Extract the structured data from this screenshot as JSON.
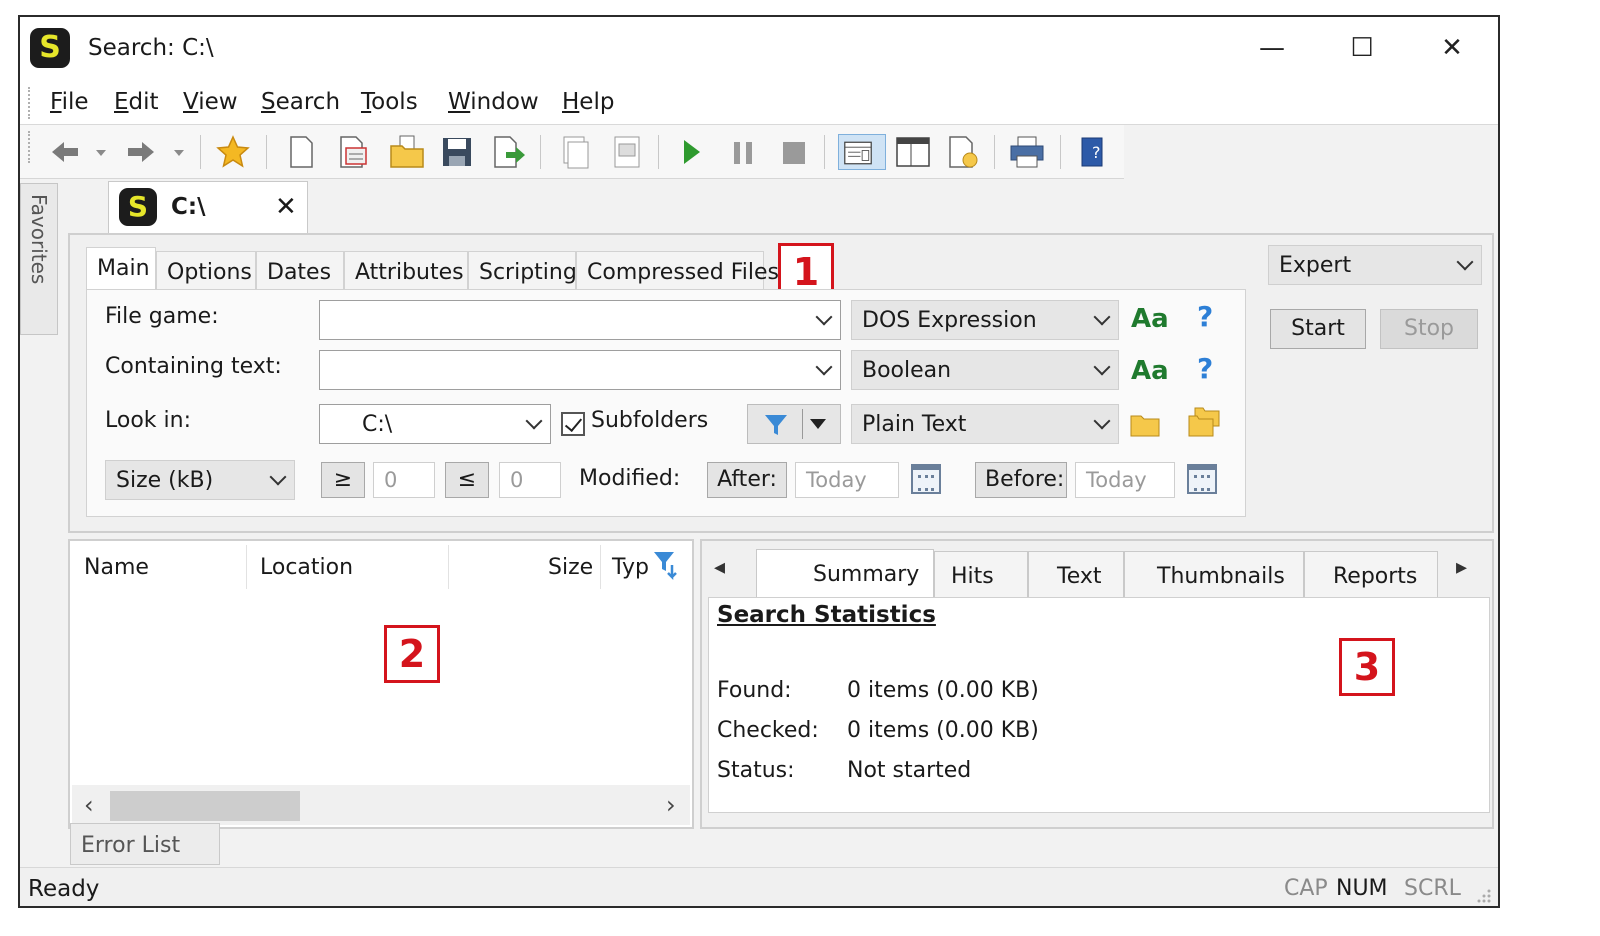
{
  "window": {
    "title": "Search: C:\\",
    "logo_letter": "S",
    "min_glyph": "—",
    "max_glyph": "☐",
    "close_glyph": "✕"
  },
  "menu": [
    "File",
    "Edit",
    "View",
    "Search",
    "Tools",
    "Window",
    "Help"
  ],
  "toolbar_icons": [
    "back-arrow-icon",
    "dropdown-arrow-icon",
    "forward-arrow-icon",
    "dropdown-arrow-icon",
    "star-favorite-icon",
    "new-document-icon",
    "open-document-icon",
    "open-folder-icon",
    "save-icon",
    "export-icon",
    "copy-page-icon",
    "print-preview-icon",
    "start-play-icon",
    "pause-icon",
    "stop-icon",
    "layout-pane-icon",
    "split-view-icon",
    "report-icon",
    "printer-icon",
    "help-book-icon"
  ],
  "favorites_label": "Favorites",
  "doc_tab": {
    "label": "C:\\",
    "close_glyph": "✕"
  },
  "search_tabs": [
    "Main",
    "Options",
    "Dates",
    "Attributes",
    "Scripting",
    "Compressed Files"
  ],
  "markers": [
    "1",
    "2",
    "3"
  ],
  "form": {
    "file_name_label": "File game:",
    "file_name_value": "",
    "file_name_mode": "DOS Expression",
    "containing_label": "Containing text:",
    "containing_value": "",
    "containing_mode": "Boolean",
    "case_glyph": "Aa",
    "help_glyph": "?",
    "look_in_label": "Look in:",
    "look_in_value": "C:\\",
    "subfolders_label": "Subfolders",
    "subfolders_checked": true,
    "text_type": "Plain Text",
    "size_unit": "Size (kB)",
    "ge_symbol": "≥",
    "le_symbol": "≤",
    "size_min": "0",
    "size_max": "0",
    "modified_label": "Modified:",
    "after_label": "After:",
    "after_value": "Today",
    "before_label": "Before:",
    "before_value": "Today"
  },
  "mode_select": "Expert",
  "start_label": "Start",
  "stop_label": "Stop",
  "results_columns": [
    "Name",
    "Location",
    "Size",
    "Typ"
  ],
  "scroll_left": "‹",
  "scroll_right": "›",
  "right_tabs": [
    "Summary",
    "Hits",
    "Text",
    "Thumbnails",
    "Reports"
  ],
  "tab_nav_left": "◂",
  "tab_nav_right": "▸",
  "summary": {
    "title": "Search Statistics",
    "found_label": "Found:",
    "found_value": "0 items (0.00 KB)",
    "checked_label": "Checked:",
    "checked_value": "0 items (0.00 KB)",
    "status_label": "Status:",
    "status_value": "Not started"
  },
  "error_tab": "Error List",
  "status": {
    "text": "Ready",
    "cap": "CAP",
    "num": "NUM",
    "scrl": "SCRL"
  },
  "colors": {
    "accent_red": "#d4141c",
    "logo_yellow": "#e6e62a",
    "case_green": "#1f7a2e",
    "help_blue": "#2d7fd6"
  }
}
